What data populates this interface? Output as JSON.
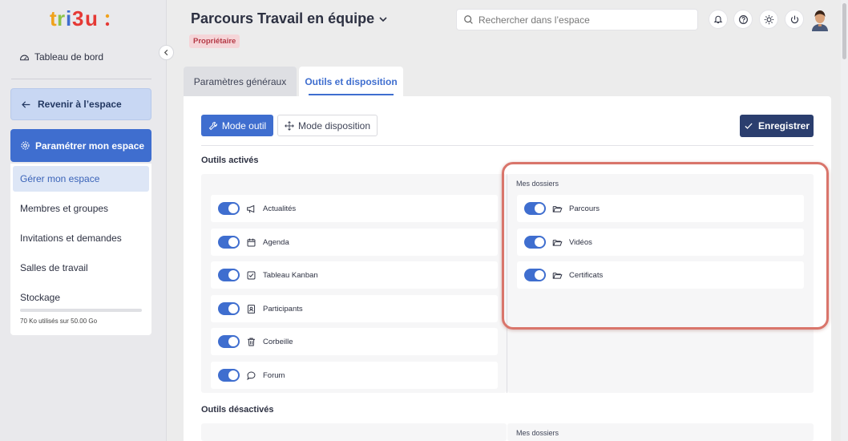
{
  "app": {
    "logo_text": "tribu:",
    "title": "Parcours Travail en équipe",
    "role_badge": "Propriétaire"
  },
  "search": {
    "placeholder": "Rechercher dans l’espace"
  },
  "sidebar": {
    "dashboard": "Tableau de bord",
    "back_button": "Revenir à l’espace",
    "settings_button": "Paramétrer mon espace",
    "items": [
      {
        "label": "Gérer mon espace",
        "active": true
      },
      {
        "label": "Membres et groupes"
      },
      {
        "label": "Invitations et demandes"
      },
      {
        "label": "Salles de travail"
      },
      {
        "label": "Stockage"
      }
    ],
    "storage_text": "70 Ko utilisés sur 50.00 Go"
  },
  "tabs": [
    {
      "label": "Paramètres généraux",
      "active": false
    },
    {
      "label": "Outils et disposition",
      "active": true
    }
  ],
  "toolbar": {
    "mode_tool": "Mode outil",
    "mode_layout": "Mode disposition",
    "save": "Enregistrer"
  },
  "sections": {
    "active_title": "Outils activés",
    "inactive_title": "Outils désactivés",
    "folders_title": "Mes dossiers",
    "folders_title_2": "Mes dossiers"
  },
  "active_tools": [
    {
      "label": "Actualités",
      "icon": "megaphone-icon",
      "enabled": true
    },
    {
      "label": "Agenda",
      "icon": "calendar-icon",
      "enabled": true
    },
    {
      "label": "Tableau Kanban",
      "icon": "checkbox-icon",
      "enabled": true
    },
    {
      "label": "Participants",
      "icon": "contact-icon",
      "enabled": true
    },
    {
      "label": "Corbeille",
      "icon": "trash-icon",
      "enabled": true
    },
    {
      "label": "Forum",
      "icon": "chat-icon",
      "enabled": true
    }
  ],
  "folders": [
    {
      "label": "Parcours",
      "icon": "folder-icon",
      "enabled": true
    },
    {
      "label": "Vidéos",
      "icon": "folder-icon",
      "enabled": true
    },
    {
      "label": "Certificats",
      "icon": "folder-icon",
      "enabled": true
    }
  ],
  "colors": {
    "primary": "#3f6ecf",
    "dark_button": "#2b3e6e",
    "badge_text": "#b43a46",
    "highlight": "#d9756b"
  }
}
